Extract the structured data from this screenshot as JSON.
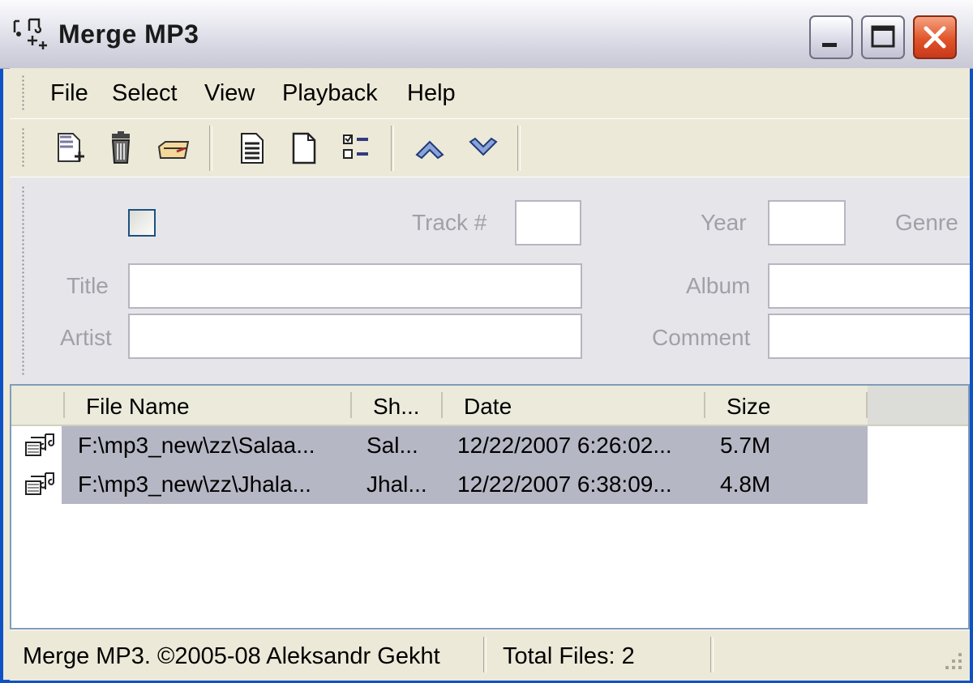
{
  "window": {
    "title": "Merge MP3"
  },
  "menu": {
    "items": [
      "File",
      "Select",
      "View",
      "Playback",
      "Help"
    ]
  },
  "toolbar": {
    "buttons": [
      "add-files-icon",
      "delete-icon",
      "open-folder-icon",
      "select-all-icon",
      "select-none-icon",
      "invert-selection-icon",
      "move-up-icon",
      "move-down-icon"
    ]
  },
  "tags": {
    "track_label": "Track #",
    "year_label": "Year",
    "genre_label": "Genre",
    "title_label": "Title",
    "album_label": "Album",
    "artist_label": "Artist",
    "comment_label": "Comment",
    "track_value": "",
    "year_value": "",
    "title_value": "",
    "album_value": "",
    "artist_value": "",
    "comment_value": "",
    "checkbox_checked": false
  },
  "list": {
    "columns": [
      "File Name",
      "Sh...",
      "Date",
      "Size"
    ],
    "rows": [
      {
        "file": "F:\\mp3_new\\zz\\Salaa...",
        "short": "Sal...",
        "date": "12/22/2007 6:26:02...",
        "size": "5.7M"
      },
      {
        "file": "F:\\mp3_new\\zz\\Jhala...",
        "short": "Jhal...",
        "date": "12/22/2007 6:38:09...",
        "size": "4.8M"
      }
    ]
  },
  "status": {
    "copyright": "Merge MP3. ©2005-08 Aleksandr Gekht",
    "total": "Total Files: 2"
  },
  "colors": {
    "selection": "#b6b7c4",
    "panel": "#e6e6ea",
    "chrome": "#ece9d8"
  }
}
